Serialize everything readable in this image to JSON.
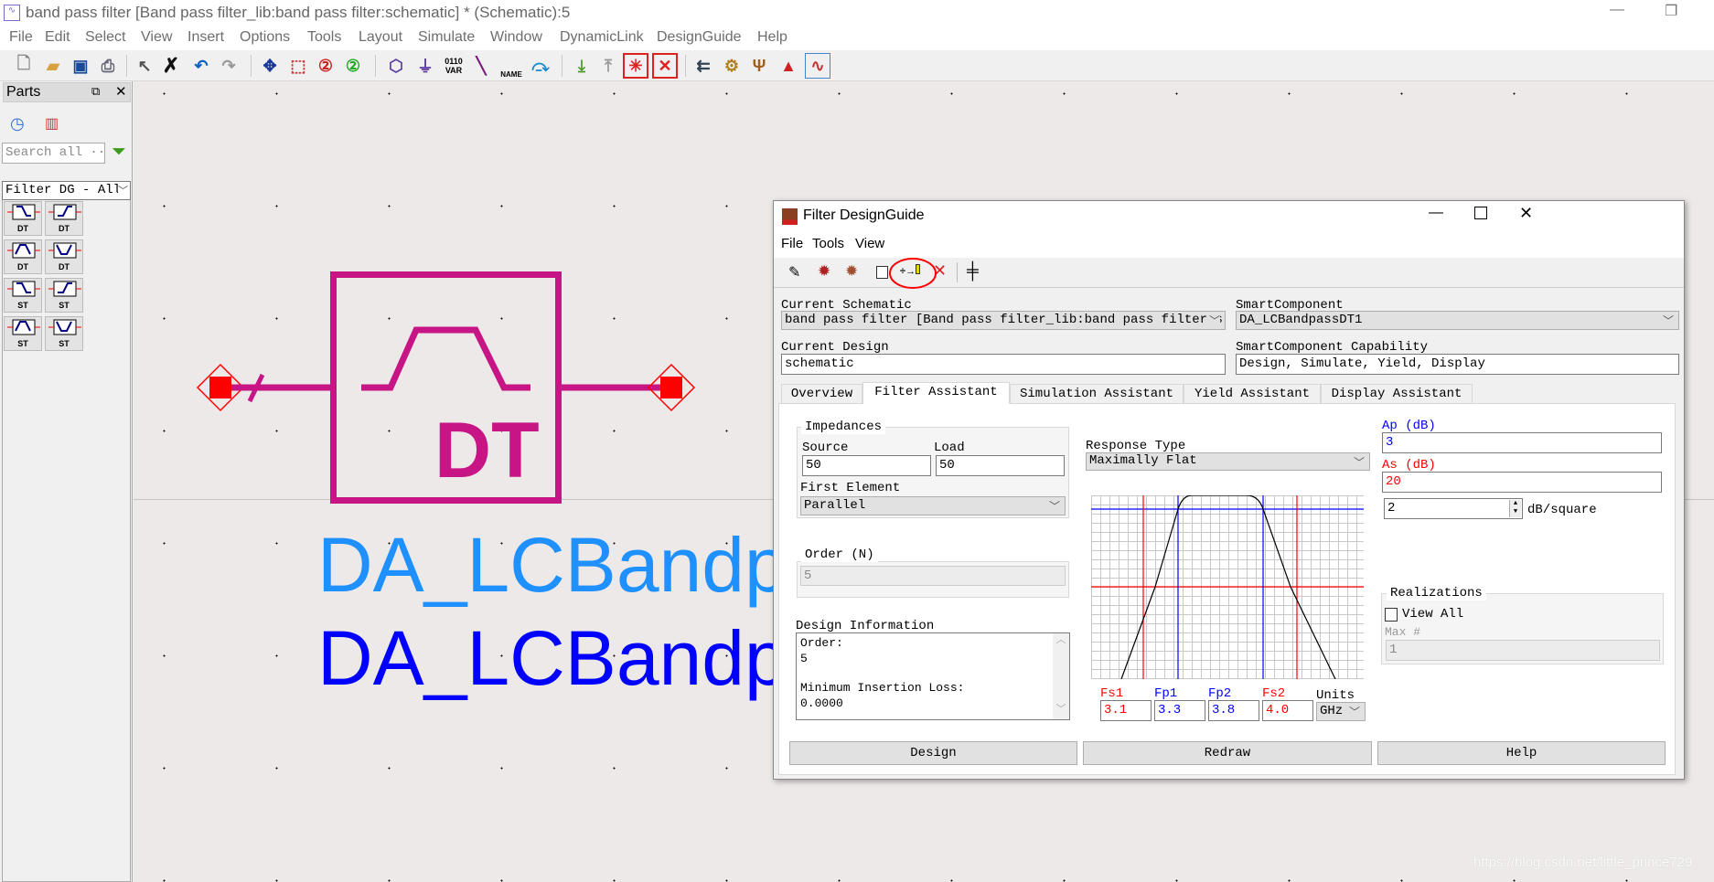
{
  "window": {
    "title": "band pass filter [Band pass filter_lib:band pass filter:schematic] * (Schematic):5"
  },
  "menu": [
    "File",
    "Edit",
    "Select",
    "View",
    "Insert",
    "Options",
    "Tools",
    "Layout",
    "Simulate",
    "Window",
    "DynamicLink",
    "DesignGuide",
    "Help"
  ],
  "toolbar": {
    "icons": [
      "new-file-icon",
      "open-folder-icon",
      "save-icon",
      "print-icon",
      "select-pointer-icon",
      "delete-x-icon",
      "undo-icon",
      "redo-icon",
      "move-icon",
      "zoom-area-icon",
      "zoom-in-icon",
      "zoom-out-icon",
      "port-icon",
      "ground-icon",
      "var-icon",
      "wire-icon",
      "name-icon",
      "swap-icon",
      "push-down-icon",
      "pop-up-icon",
      "deactivate-icon",
      "short-icon",
      "gen-layout-icon",
      "gear-icon",
      "tuning-icon",
      "simulate-icon",
      "display-data-icon"
    ],
    "var_label": "0110 VAR",
    "name_label": "NAME"
  },
  "parts": {
    "title": "Parts",
    "search_placeholder": "Search all ···",
    "library": "Filter DG - All",
    "cells": [
      "DT",
      "DT",
      "DT",
      "DT",
      "ST",
      "ST",
      "ST",
      "ST"
    ]
  },
  "schematic": {
    "symbol_label": "DT",
    "instance_name": "DA_LCBandp",
    "instance_name2": "DA_LCBandp",
    "symbol_color": "#c71585"
  },
  "watermark": "https://blog.csdn.net/little_prince729",
  "dialog": {
    "title": "Filter DesignGuide",
    "menu": [
      "File",
      "Tools",
      "View"
    ],
    "current_schematic_label": "Current Schematic",
    "current_schematic": "band pass filter [Band pass filter_lib:band pass filter:s",
    "smart_component_label": "SmartComponent",
    "smart_component": "DA_LCBandpassDT1",
    "current_design_label": "Current Design",
    "current_design": "schematic",
    "capability_label": "SmartComponent Capability",
    "capability": "Design, Simulate, Yield, Display",
    "tabs": [
      "Overview",
      "Filter Assistant",
      "Simulation Assistant",
      "Yield Assistant",
      "Display Assistant"
    ],
    "active_tab": "Filter Assistant",
    "impedances": {
      "label": "Impedances",
      "source_label": "Source",
      "source": "50",
      "load_label": "Load",
      "load": "50",
      "first_element_label": "First Element",
      "first_element": "Parallel"
    },
    "order": {
      "label": "Order (N)",
      "value": "5"
    },
    "design_info": {
      "label": "Design Information",
      "lines": [
        "Order:",
        "5",
        "",
        "Minimum Insertion Loss:",
        "0.0000"
      ]
    },
    "response_type_label": "Response Type",
    "response_type": "Maximally Flat",
    "ap_label": "Ap (dB)",
    "ap": "3",
    "as_label": "As (dB)",
    "as": "20",
    "slope": "2",
    "slope_unit": "dB/square",
    "edges": {
      "fs1_label": "Fs1",
      "fs1": "3.1",
      "fp1_label": "Fp1",
      "fp1": "3.3",
      "fp2_label": "Fp2",
      "fp2": "3.8",
      "fs2_label": "Fs2",
      "fs2": "4.0",
      "units_label": "Units",
      "units": "GHz"
    },
    "realizations": {
      "label": "Realizations",
      "view_all": "View All",
      "view_all_checked": false,
      "max_label": "Max #",
      "max": "1"
    },
    "buttons": {
      "design": "Design",
      "redraw": "Redraw",
      "help": "Help"
    },
    "colors": {
      "stop": "#ff0000",
      "pass": "#0000ff"
    }
  }
}
